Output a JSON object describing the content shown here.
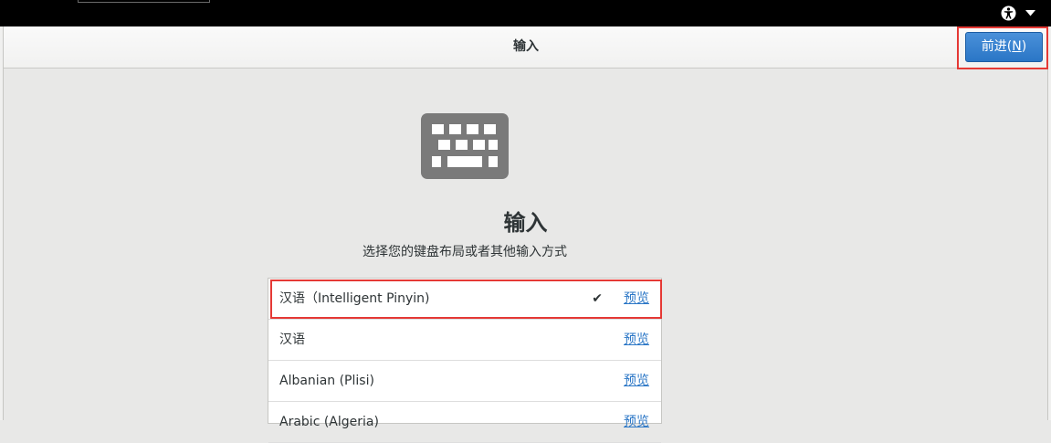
{
  "header": {
    "title": "输入",
    "next_label_text": "前进(",
    "next_mnemonic": "N",
    "next_label_end": ")"
  },
  "system_bar": {
    "icons": [
      "accessibility-icon",
      "chevron-down-icon"
    ]
  },
  "main": {
    "heading": "输入",
    "subtitle": "选择您的键盘布局或者其他输入方式",
    "icon": "keyboard-icon"
  },
  "layouts": [
    {
      "label": "汉语（Intelligent Pinyin)",
      "selected": true,
      "preview": "预览"
    },
    {
      "label": "汉语",
      "selected": false,
      "preview": "预览"
    },
    {
      "label": "Albanian (Plisi)",
      "selected": false,
      "preview": "预览"
    },
    {
      "label": "Arabic (Algeria)",
      "selected": false,
      "preview": "预览"
    }
  ],
  "selected_mark": "✔",
  "colors": {
    "accent": "#2a76c6",
    "highlight": "#e53935",
    "topbar": "#000000",
    "background": "#e8e8e7"
  }
}
